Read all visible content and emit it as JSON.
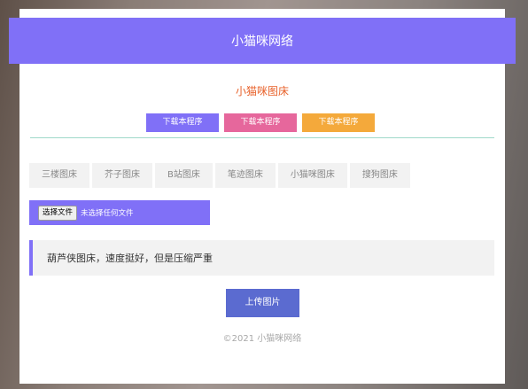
{
  "header": {
    "title": "小猫咪网络"
  },
  "subtitle": "小猫咪图床",
  "download_buttons": [
    {
      "label": "下载本程序",
      "color": "#8070f7"
    },
    {
      "label": "下载本程序",
      "color": "#e6679c"
    },
    {
      "label": "下载本程序",
      "color": "#f4a93b"
    }
  ],
  "tabs": [
    "三楼图床",
    "芥子图床",
    "B站图床",
    "笔迹图床",
    "小猫咪图床",
    "搜狗图床"
  ],
  "file_input": {
    "button_label": "选择文件",
    "status": "未选择任何文件"
  },
  "notice": "葫芦侠图床，速度挺好，但是压缩严重",
  "upload_button": "上传图片",
  "footer": "©2021 小猫咪网络",
  "colors": {
    "accent": "#8070f7",
    "upload": "#5b6bd0",
    "subtitle": "#e8622b"
  }
}
